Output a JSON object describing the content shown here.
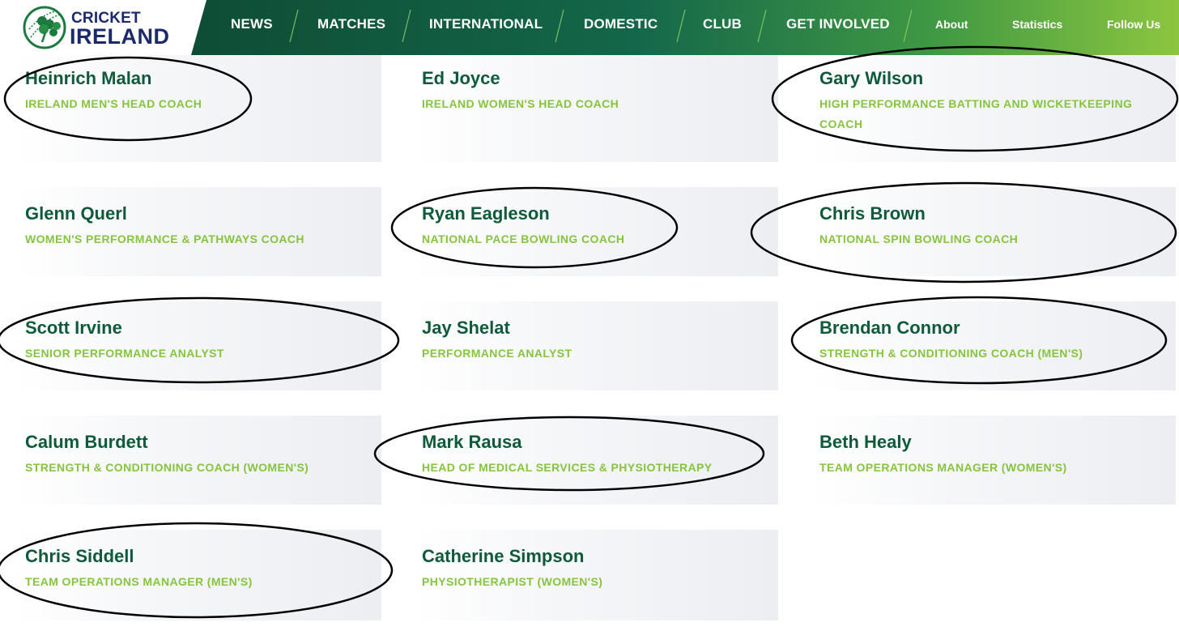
{
  "logo": {
    "line1": "CRICKET",
    "line2": "IRELAND"
  },
  "nav": {
    "main": [
      "NEWS",
      "MATCHES",
      "INTERNATIONAL",
      "DOMESTIC",
      "CLUB",
      "GET INVOLVED"
    ],
    "secondary": [
      "About",
      "Statistics",
      "Follow Us"
    ]
  },
  "staff": [
    {
      "name": "Heinrich Malan",
      "role": "IRELAND MEN'S HEAD COACH",
      "circled": true
    },
    {
      "name": "Ed Joyce",
      "role": "IRELAND WOMEN'S HEAD COACH",
      "circled": false
    },
    {
      "name": "Gary Wilson",
      "role": "HIGH PERFORMANCE BATTING AND WICKETKEEPING COACH",
      "circled": true
    },
    {
      "name": "Glenn Querl",
      "role": "WOMEN'S PERFORMANCE & PATHWAYS COACH",
      "circled": false
    },
    {
      "name": "Ryan Eagleson",
      "role": "NATIONAL PACE BOWLING COACH",
      "circled": true
    },
    {
      "name": "Chris Brown",
      "role": "NATIONAL SPIN BOWLING COACH",
      "circled": true
    },
    {
      "name": "Scott Irvine",
      "role": "SENIOR PERFORMANCE ANALYST",
      "circled": true
    },
    {
      "name": "Jay Shelat",
      "role": "PERFORMANCE ANALYST",
      "circled": false
    },
    {
      "name": "Brendan Connor",
      "role": "STRENGTH & CONDITIONING COACH (MEN'S)",
      "circled": true
    },
    {
      "name": "Calum Burdett",
      "role": "STRENGTH & CONDITIONING COACH (WOMEN'S)",
      "circled": false
    },
    {
      "name": "Mark Rausa",
      "role": "HEAD OF MEDICAL SERVICES & PHYSIOTHERAPY",
      "circled": true
    },
    {
      "name": "Beth Healy",
      "role": "TEAM OPERATIONS MANAGER (WOMEN'S)",
      "circled": false
    },
    {
      "name": "Chris Siddell",
      "role": "TEAM OPERATIONS MANAGER (MEN'S)",
      "circled": true
    },
    {
      "name": "Catherine Simpson",
      "role": "PHYSIOTHERAPIST (WOMEN'S)",
      "circled": false
    }
  ],
  "colors": {
    "brand_navy": "#1b2a6b",
    "nav_dark_green": "#0f5a3a",
    "nav_light_green": "#7cc242",
    "name_green": "#0f5a3a",
    "role_green": "#86c440",
    "annotation": "#000000"
  }
}
